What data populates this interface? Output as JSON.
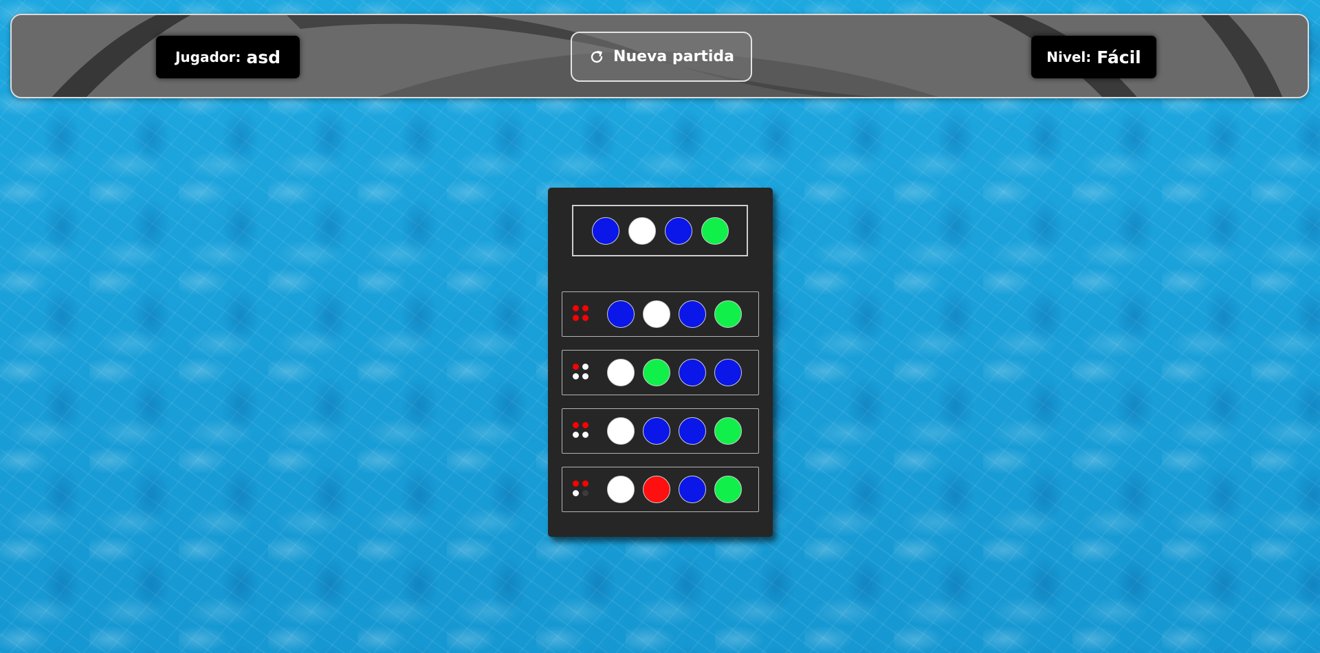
{
  "header": {
    "player": {
      "label": "Jugador:",
      "name": "asd"
    },
    "new_game": {
      "label": "Nueva partida",
      "icon": "refresh-icon"
    },
    "level": {
      "label": "Nivel:",
      "value": "Fácil"
    }
  },
  "colors": {
    "blue": "#0b16e8",
    "white": "#ffffff",
    "green": "#11f04a",
    "red": "#ff0f0f",
    "hint_red": "#ff0000",
    "hint_white": "#ffffff",
    "hint_empty": "#3c3c3c",
    "board": "#262626",
    "water": "#1aa3dc"
  },
  "board": {
    "secret": [
      "blue",
      "white",
      "blue",
      "green"
    ],
    "attempts": [
      {
        "guess": [
          "blue",
          "white",
          "blue",
          "green"
        ],
        "hints": [
          "red",
          "red",
          "red",
          "red"
        ]
      },
      {
        "guess": [
          "white",
          "green",
          "blue",
          "blue"
        ],
        "hints": [
          "red",
          "white",
          "white",
          "white"
        ]
      },
      {
        "guess": [
          "white",
          "blue",
          "blue",
          "green"
        ],
        "hints": [
          "red",
          "red",
          "white",
          "white"
        ]
      },
      {
        "guess": [
          "white",
          "red",
          "blue",
          "green"
        ],
        "hints": [
          "red",
          "red",
          "white",
          "empty"
        ]
      }
    ]
  }
}
